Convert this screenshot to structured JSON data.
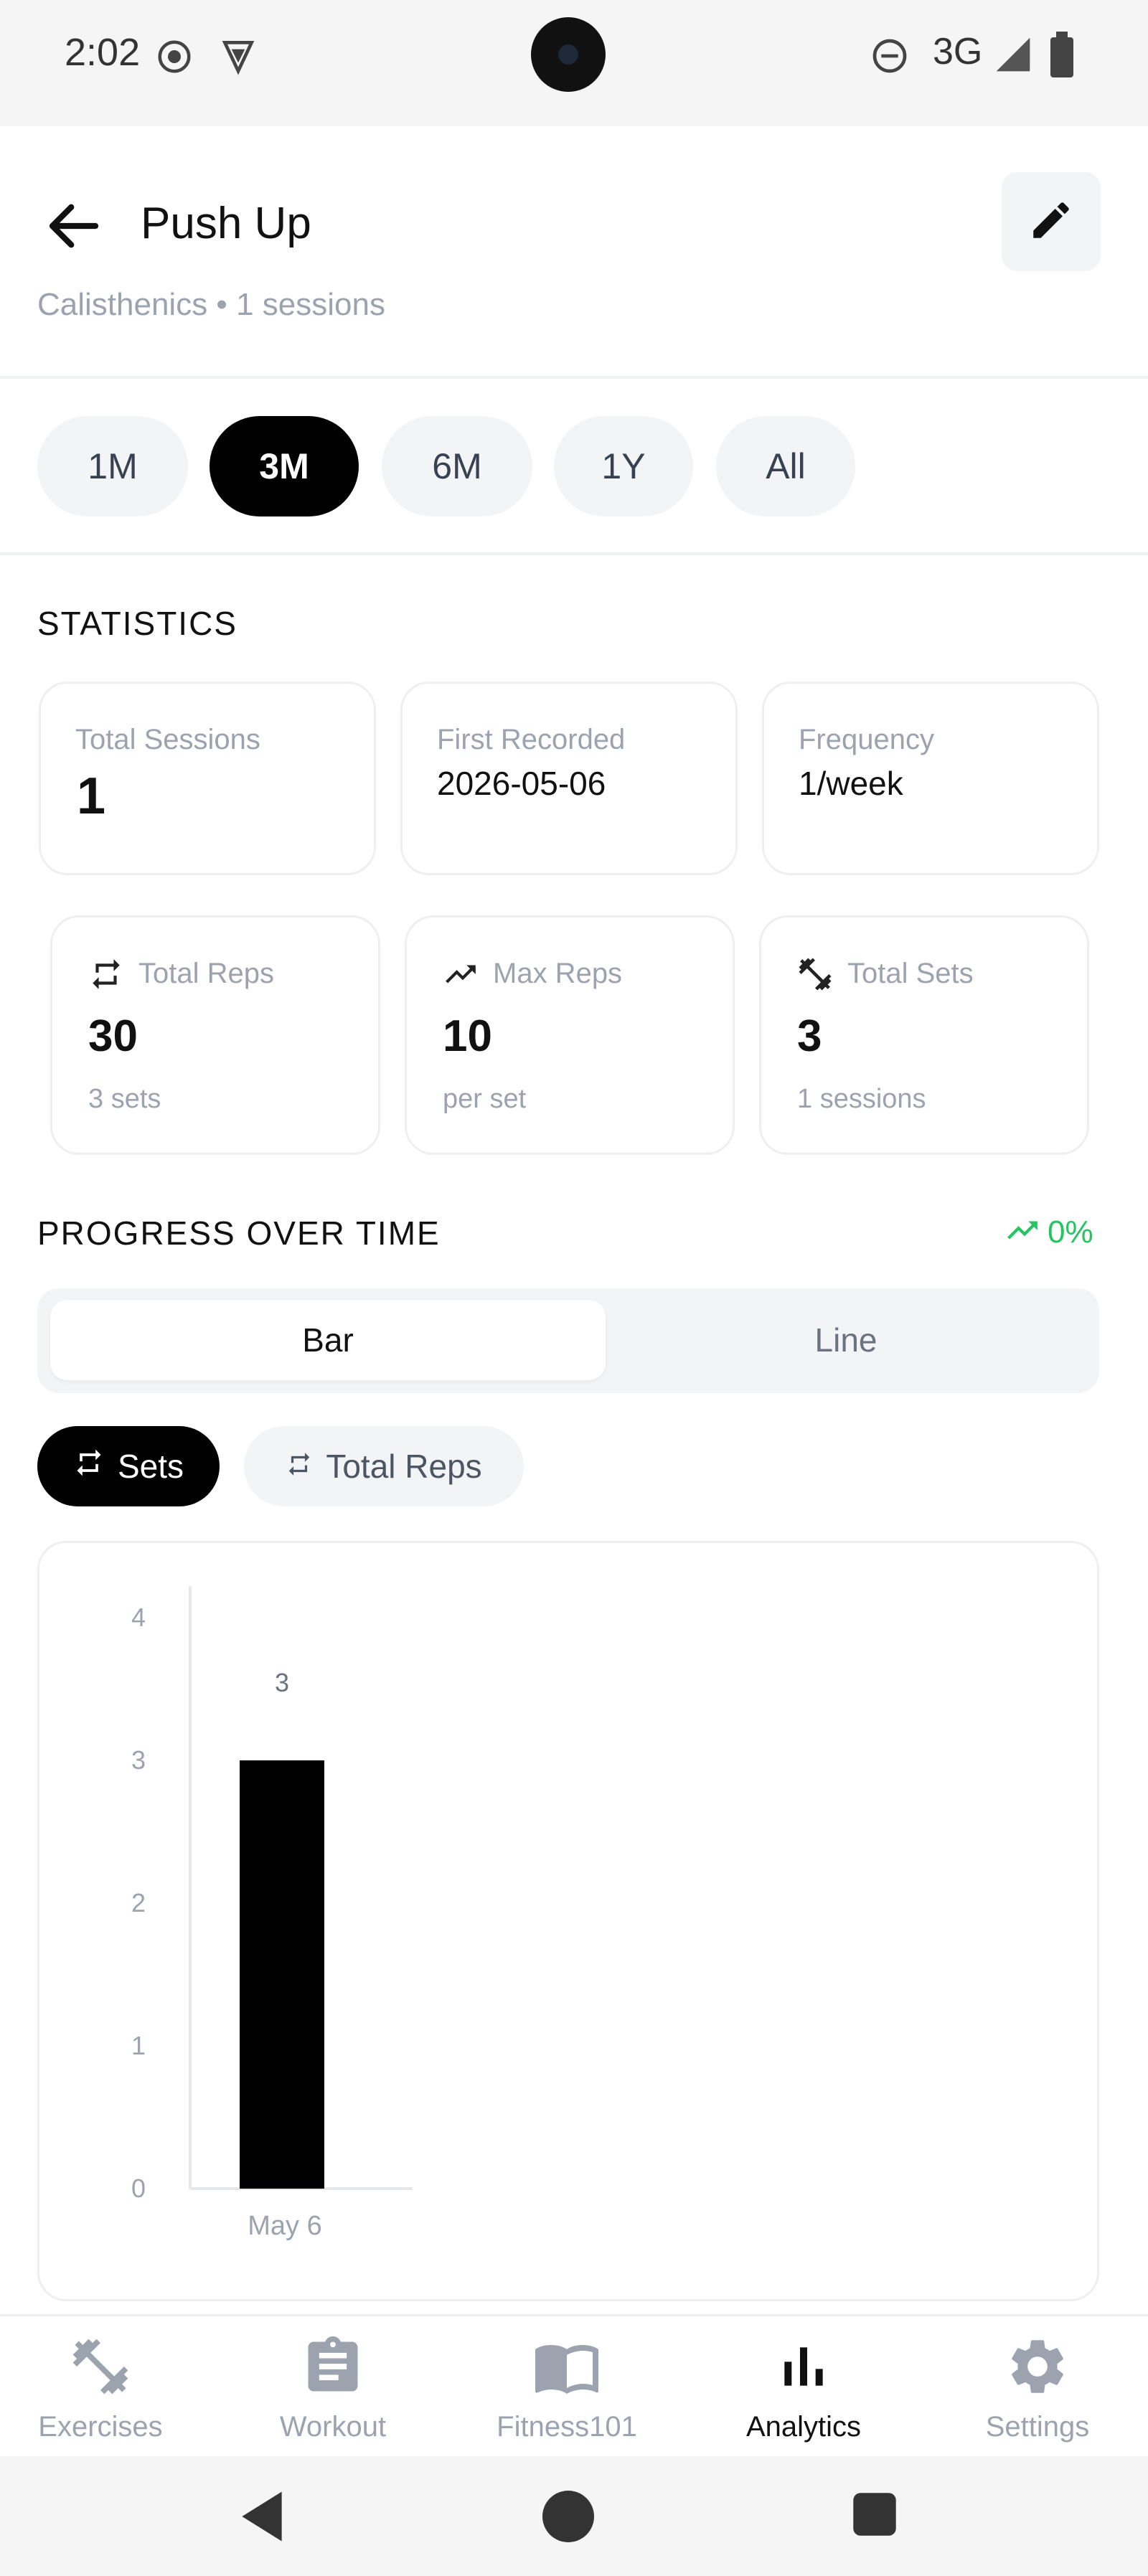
{
  "status_bar": {
    "time": "2:02",
    "network": "3G",
    "icons": [
      "record-icon",
      "vpn-shield-icon",
      "dnd-icon",
      "signal-icon",
      "battery-icon"
    ]
  },
  "header": {
    "title": "Push Up",
    "subtitle": "Calisthenics • 1 sessions",
    "back_icon": "arrow-left-icon",
    "edit_icon": "pencil-icon"
  },
  "ranges": {
    "items": [
      {
        "label": "1M",
        "active": false
      },
      {
        "label": "3M",
        "active": true
      },
      {
        "label": "6M",
        "active": false
      },
      {
        "label": "1Y",
        "active": false
      },
      {
        "label": "All",
        "active": false
      }
    ]
  },
  "statistics": {
    "title": "STATISTICS",
    "total_sessions": {
      "label": "Total Sessions",
      "value": "1"
    },
    "first_recorded": {
      "label": "First Recorded",
      "value": "2026-05-06"
    },
    "frequency": {
      "label": "Frequency",
      "value": "1/week"
    },
    "total_reps": {
      "label": "Total Reps",
      "value": "30",
      "sub": "3 sets",
      "icon": "repeat-icon"
    },
    "max_reps": {
      "label": "Max Reps",
      "value": "10",
      "sub": "per set",
      "icon": "trending-up-icon"
    },
    "total_sets": {
      "label": "Total Sets",
      "value": "3",
      "sub": "1 sessions",
      "icon": "dumbbell-icon"
    }
  },
  "progress": {
    "title": "PROGRESS OVER TIME",
    "change": "0%",
    "change_color": "#22c55e",
    "toggle": {
      "bar": "Bar",
      "line": "Line",
      "active": "bar"
    },
    "metrics": [
      {
        "label": "Sets",
        "active": true,
        "icon": "repeat-icon"
      },
      {
        "label": "Total Reps",
        "active": false,
        "icon": "repeat-small-icon"
      }
    ]
  },
  "chart_data": {
    "type": "bar",
    "categories": [
      "May 6"
    ],
    "values": [
      3
    ],
    "data_labels": [
      "3"
    ],
    "yticks": [
      "0",
      "1",
      "2",
      "3",
      "4"
    ],
    "ylim": [
      0,
      4
    ],
    "bar_color": "#000000",
    "title": "",
    "xlabel": "",
    "ylabel": "",
    "grid": false
  },
  "bottom_nav": {
    "items": [
      {
        "label": "Exercises",
        "icon": "dumbbell-icon",
        "active": false
      },
      {
        "label": "Workout",
        "icon": "clipboard-icon",
        "active": false
      },
      {
        "label": "Fitness101",
        "icon": "book-icon",
        "active": false
      },
      {
        "label": "Analytics",
        "icon": "bar-chart-icon",
        "active": true
      },
      {
        "label": "Settings",
        "icon": "gear-icon",
        "active": false
      }
    ]
  },
  "system_nav": {
    "icons": [
      "back-triangle-icon",
      "home-circle-icon",
      "recents-square-icon"
    ]
  }
}
